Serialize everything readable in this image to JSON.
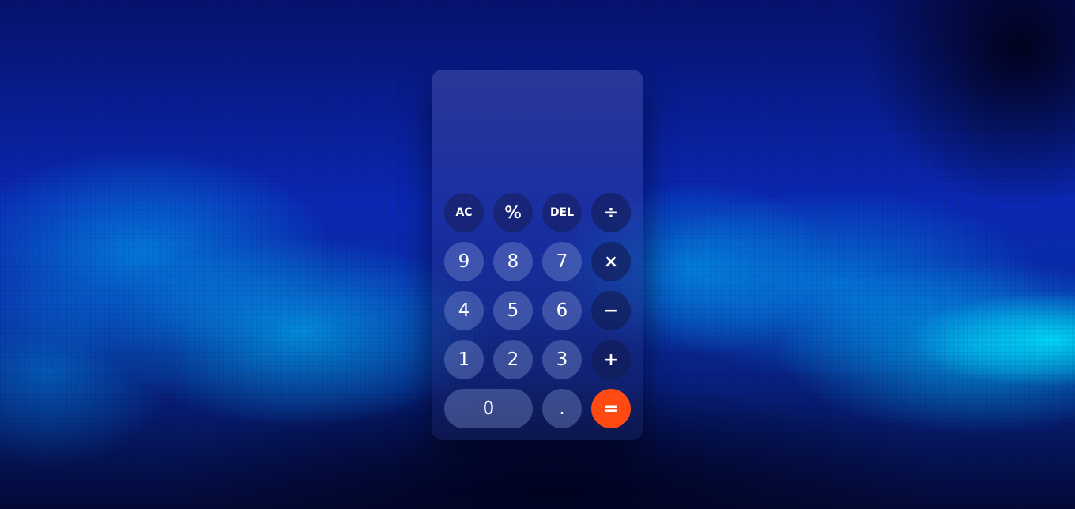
{
  "calculator": {
    "display_value": "",
    "keys": {
      "clear": "AC",
      "percent": "%",
      "delete": "DEL",
      "divide": "÷",
      "seven": "7",
      "eight": "8",
      "nine": "9",
      "multiply": "×",
      "four": "4",
      "five": "5",
      "six": "6",
      "subtract": "−",
      "one": "1",
      "two": "2",
      "three": "3",
      "add": "+",
      "zero": "0",
      "decimal": ".",
      "equals": "="
    },
    "accent_color": "#ff4a12"
  }
}
